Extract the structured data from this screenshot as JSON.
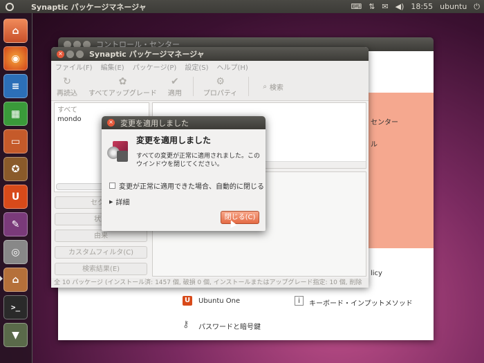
{
  "panel": {
    "app_title": "Synaptic パッケージマネージャ",
    "clock": "18:55",
    "user": "ubuntu"
  },
  "launcher": {
    "items": [
      "home-folder",
      "firefox",
      "writer",
      "calc",
      "impress",
      "software-center",
      "ubuntu-one",
      "system-settings",
      "screenshot",
      "home-alt",
      "terminal",
      "installer"
    ]
  },
  "control_center": {
    "title": "コントロール・センター",
    "items": [
      {
        "label": "センター"
      },
      {
        "label": "ル"
      },
      {
        "label": "licy"
      },
      {
        "label": "Ubuntu One"
      },
      {
        "label": "キーボード・インプットメソッド"
      },
      {
        "label": "パスワードと暗号鍵"
      }
    ]
  },
  "synaptic": {
    "title": "Synaptic パッケージマネージャ",
    "menu": [
      "ファイル(F)",
      "編集(E)",
      "パッケージ(P)",
      "設定(S)",
      "ヘルプ(H)"
    ],
    "toolbar": {
      "reload": "再読込",
      "mark_all": "すべてアップグレード",
      "apply": "適用",
      "properties": "プロパティ",
      "search": "検索"
    },
    "filters": [
      "すべて",
      "mondo"
    ],
    "side_buttons": [
      "セクシ",
      "状態",
      "由来",
      "カスタムフィルタ(C)",
      "検索結果(E)"
    ],
    "status_bar": "全 10 パッケージ (インストール済: 1457 個, 破損 0 個, インストールまたはアップグレード指定: 10 個, 削除"
  },
  "dialog": {
    "title": "変更を適用しました",
    "heading": "変更を適用しました",
    "message": "すべての変更が正常に適用されました。このウインドウを閉じてください。",
    "checkbox_label": "変更が正常に適用できた場合、自動的に閉じる",
    "details": "詳細",
    "close_button": "閉じる(C)"
  },
  "colors": {
    "accent": "#e46a44",
    "salmon": "#f5a88f"
  }
}
